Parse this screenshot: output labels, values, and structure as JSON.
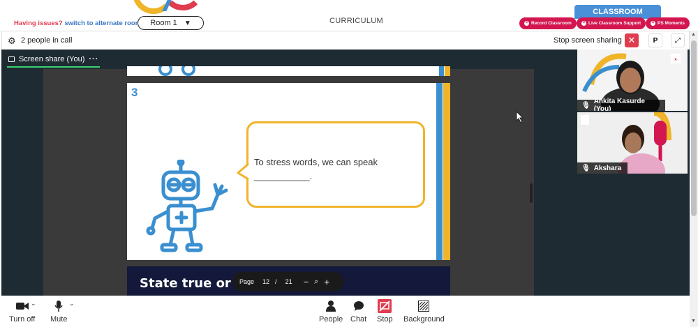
{
  "top": {
    "issue_prefix": "Having issues?",
    "issue_link": "switch to alternate room",
    "room_label": "Room 1",
    "curriculum": "CURRICULUM",
    "classroom": "CLASSROOM",
    "pills": [
      "Record Classroom",
      "Live Classroom Support",
      "PS Moments"
    ]
  },
  "call": {
    "people_count": "2 people in call",
    "stop_sharing": "Stop screen sharing",
    "p_label": "P"
  },
  "screen_share_tab": "Screen share (You)",
  "slide": {
    "number": "3",
    "text": "To stress words, we can speak",
    "blank": "___________.",
    "next_title": "State true or false."
  },
  "page_control": {
    "page_label": "Page",
    "current": "12",
    "sep": "/",
    "total": "21"
  },
  "participants": [
    {
      "name": "Ankita Kasurde (You)"
    },
    {
      "name": "Akshara"
    }
  ],
  "bottom": {
    "turn_off": "Turn off",
    "mute": "Mute",
    "people": "People",
    "chat": "Chat",
    "stop": "Stop",
    "background": "Background"
  },
  "colors": {
    "accent_red": "#d3164f",
    "blue": "#3a8fd0",
    "yellow": "#f0b429",
    "green": "#3bd16f"
  }
}
